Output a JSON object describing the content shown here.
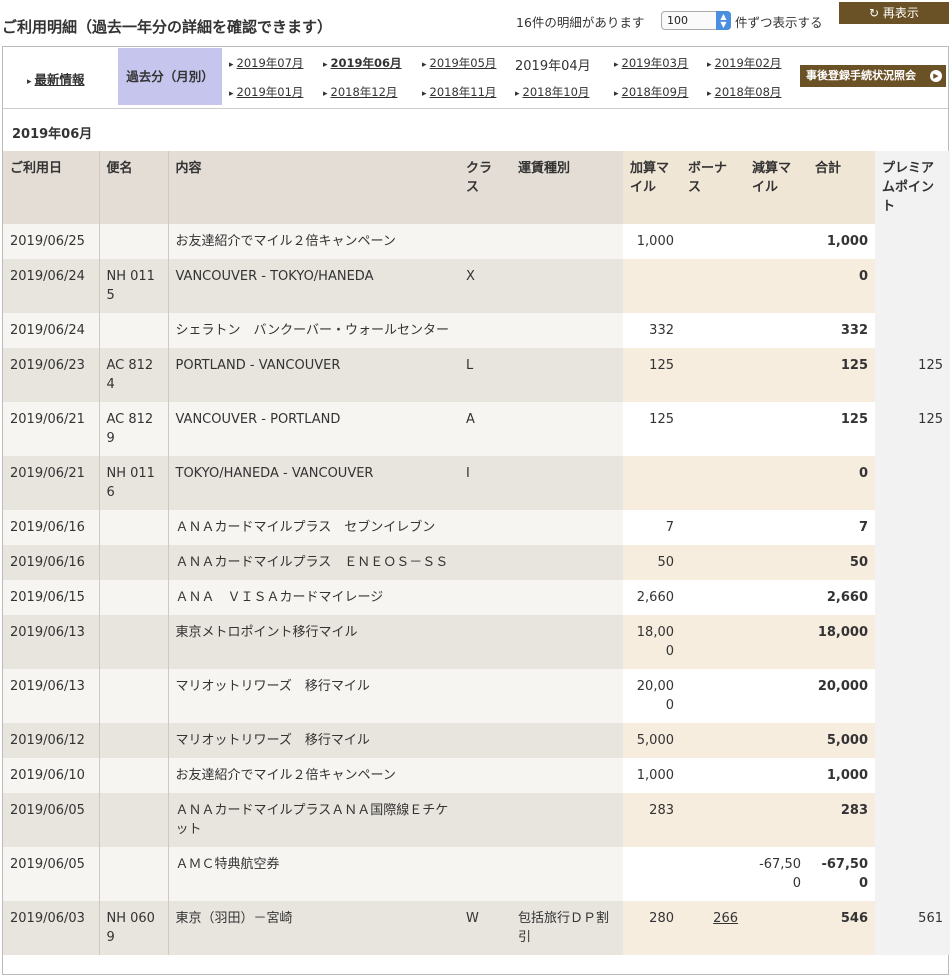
{
  "header": {
    "title": "ご利用明細（過去一年分の詳細を確認できます）",
    "count_text": "16件の明細があります",
    "per_page_value": "100",
    "per_page_suffix": "件ずつ表示する",
    "redisplay_label": "再表示"
  },
  "nav": {
    "latest_label": "最新情報",
    "past_label": "過去分（月別）",
    "months": [
      "2019年07月",
      "2019年06月",
      "2019年05月",
      "2019年04月",
      "2019年03月",
      "2019年02月",
      "2019年01月",
      "2018年12月",
      "2018年11月",
      "2018年10月",
      "2018年09月",
      "2018年08月"
    ],
    "selected_month": "2019年06月",
    "plain_month": "2019年04月",
    "post_reg_label": "事後登録手続状況照会"
  },
  "section_title": "2019年06月",
  "columns": [
    "ご利用日",
    "便名",
    "内容",
    "クラス",
    "運賃種別",
    "加算マイル",
    "ボーナス",
    "減算マイル",
    "合計",
    "プレミアムポイント"
  ],
  "rows": [
    {
      "date": "2019/06/25",
      "flight": "",
      "content": "お友達紹介でマイル２倍キャンペーン",
      "cls": "",
      "fare": "",
      "add": "1,000",
      "bonus": "",
      "sub": "",
      "total": "1,000",
      "pp": ""
    },
    {
      "date": "2019/06/24",
      "flight": "NH 0115",
      "content": "VANCOUVER - TOKYO/HANEDA",
      "cls": "X",
      "fare": "",
      "add": "",
      "bonus": "",
      "sub": "",
      "total": "0",
      "pp": ""
    },
    {
      "date": "2019/06/24",
      "flight": "",
      "content": "シェラトン　バンクーバー・ウォールセンター",
      "cls": "",
      "fare": "",
      "add": "332",
      "bonus": "",
      "sub": "",
      "total": "332",
      "pp": ""
    },
    {
      "date": "2019/06/23",
      "flight": "AC 8124",
      "content": "PORTLAND - VANCOUVER",
      "cls": "L",
      "fare": "",
      "add": "125",
      "bonus": "",
      "sub": "",
      "total": "125",
      "pp": "125"
    },
    {
      "date": "2019/06/21",
      "flight": "AC 8129",
      "content": "VANCOUVER - PORTLAND",
      "cls": "A",
      "fare": "",
      "add": "125",
      "bonus": "",
      "sub": "",
      "total": "125",
      "pp": "125"
    },
    {
      "date": "2019/06/21",
      "flight": "NH 0116",
      "content": "TOKYO/HANEDA - VANCOUVER",
      "cls": "I",
      "fare": "",
      "add": "",
      "bonus": "",
      "sub": "",
      "total": "0",
      "pp": ""
    },
    {
      "date": "2019/06/16",
      "flight": "",
      "content": "ＡＮＡカードマイルプラス　セブンイレブン",
      "cls": "",
      "fare": "",
      "add": "7",
      "bonus": "",
      "sub": "",
      "total": "7",
      "pp": ""
    },
    {
      "date": "2019/06/16",
      "flight": "",
      "content": "ＡＮＡカードマイルプラス　ＥＮＥＯＳ－ＳＳ",
      "cls": "",
      "fare": "",
      "add": "50",
      "bonus": "",
      "sub": "",
      "total": "50",
      "pp": ""
    },
    {
      "date": "2019/06/15",
      "flight": "",
      "content": "ＡＮＡ　ＶＩＳＡカードマイレージ",
      "cls": "",
      "fare": "",
      "add": "2,660",
      "bonus": "",
      "sub": "",
      "total": "2,660",
      "pp": ""
    },
    {
      "date": "2019/06/13",
      "flight": "",
      "content": "東京メトロポイント移行マイル",
      "cls": "",
      "fare": "",
      "add": "18,000",
      "bonus": "",
      "sub": "",
      "total": "18,000",
      "pp": ""
    },
    {
      "date": "2019/06/13",
      "flight": "",
      "content": "マリオットリワーズ　移行マイル",
      "cls": "",
      "fare": "",
      "add": "20,000",
      "bonus": "",
      "sub": "",
      "total": "20,000",
      "pp": ""
    },
    {
      "date": "2019/06/12",
      "flight": "",
      "content": "マリオットリワーズ　移行マイル",
      "cls": "",
      "fare": "",
      "add": "5,000",
      "bonus": "",
      "sub": "",
      "total": "5,000",
      "pp": ""
    },
    {
      "date": "2019/06/10",
      "flight": "",
      "content": "お友達紹介でマイル２倍キャンペーン",
      "cls": "",
      "fare": "",
      "add": "1,000",
      "bonus": "",
      "sub": "",
      "total": "1,000",
      "pp": ""
    },
    {
      "date": "2019/06/05",
      "flight": "",
      "content": "ＡＮＡカードマイルプラスＡＮＡ国際線Ｅチケット",
      "cls": "",
      "fare": "",
      "add": "283",
      "bonus": "",
      "sub": "",
      "total": "283",
      "pp": ""
    },
    {
      "date": "2019/06/05",
      "flight": "",
      "content": "ＡＭＣ特典航空券",
      "cls": "",
      "fare": "",
      "add": "",
      "bonus": "",
      "sub": "-67,500",
      "total": "-67,500",
      "pp": ""
    },
    {
      "date": "2019/06/03",
      "flight": "NH 0609",
      "content": "東京（羽田）－宮崎",
      "cls": "W",
      "fare": "包括旅行ＤＰ割引",
      "add": "280",
      "bonus": "266",
      "sub": "",
      "total": "546",
      "pp": "561"
    }
  ],
  "colors": {
    "accent_button": "#6b5226",
    "selected_tab": "#c5c5ee",
    "header_bg": "#e3ddd6",
    "mile_header_bg": "#f0e6d6",
    "row_odd": "#f7f5f2",
    "row_even": "#e8e4de",
    "mile_odd": "#ffffff",
    "mile_even": "#f7eddf"
  }
}
